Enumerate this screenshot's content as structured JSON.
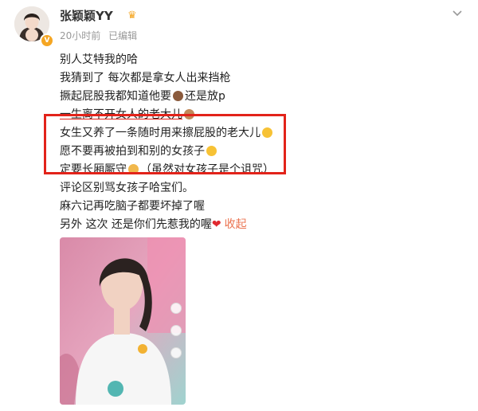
{
  "post": {
    "author": "张颖颖YY",
    "time": "20小时前",
    "edited": "已编辑",
    "lines": [
      "别人艾特我的哈",
      "我猜到了 每次都是拿女人出来挡枪",
      "撅起屁股我都知道他要",
      "还是放p",
      "一生离不开女人的老大儿",
      "女生又养了一条随时用来擦屁股的老大儿",
      "愿不要再被拍到和别的女孩子",
      "定要长厢厮守",
      "（虽然对女孩子是个诅咒）",
      "评论区别骂女孩子哈宝们。",
      "麻六记再吃脑子都要坏掉了喔",
      "另外 这次 还是你们先惹我的喔",
      "收起"
    ]
  },
  "colors": {
    "highlight_border": "#e2231a",
    "collapse_link": "#eb7350",
    "badge": "#f5a623",
    "meta_text": "#999999"
  },
  "icons": [
    "avatar",
    "verified-badge-icon",
    "crown-icon",
    "chevron-down-icon",
    "poop-emoji-icon",
    "wink-emoji-icon",
    "blush-emoji-icon",
    "pray-emoji-icon",
    "heart-emoji-icon"
  ]
}
